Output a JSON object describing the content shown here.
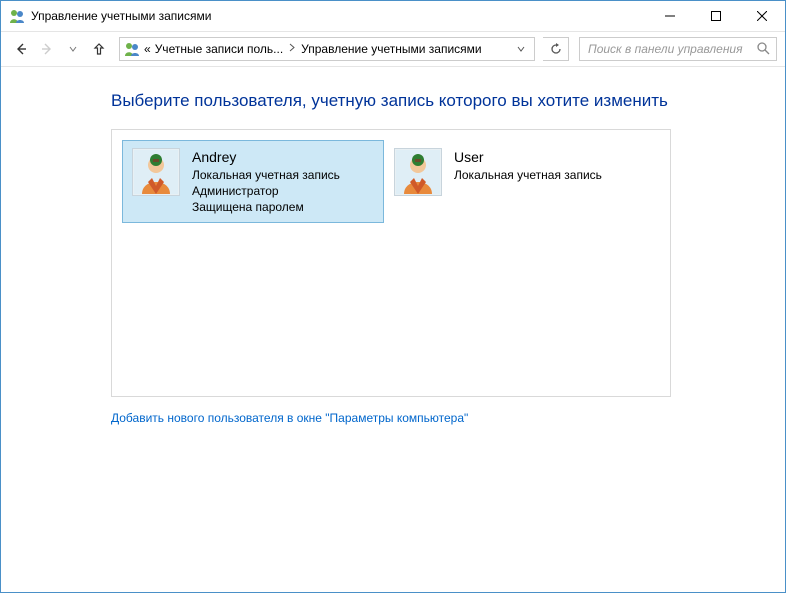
{
  "window": {
    "title": "Управление учетными записями"
  },
  "breadcrumb": {
    "prefix": "«",
    "seg1": "Учетные записи поль...",
    "seg2": "Управление учетными записями"
  },
  "search": {
    "placeholder": "Поиск в панели управления"
  },
  "page": {
    "heading": "Выберите пользователя, учетную запись которого вы хотите изменить"
  },
  "accounts": [
    {
      "name": "Andrey",
      "line1": "Локальная учетная запись",
      "line2": "Администратор",
      "line3": "Защищена паролем",
      "selected": true
    },
    {
      "name": "User",
      "line1": "Локальная учетная запись",
      "line2": "",
      "line3": "",
      "selected": false
    }
  ],
  "addlink": "Добавить нового пользователя в окне \"Параметры компьютера\""
}
